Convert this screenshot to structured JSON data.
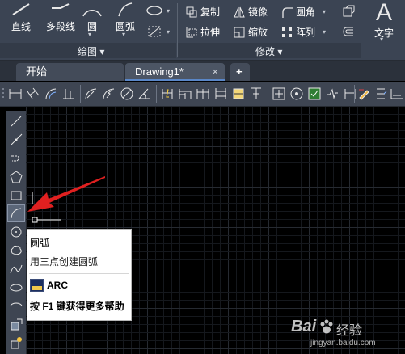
{
  "ribbon": {
    "draw": {
      "line_label": "直线",
      "polyline_label": "多段线",
      "circle_label": "圆",
      "arc_label": "圆弧",
      "panel_title": "绘图 ▾"
    },
    "modify": {
      "copy_label": "复制",
      "mirror_label": "镜像",
      "fillet_label": "圆角",
      "stretch_label": "拉伸",
      "scale_label": "缩放",
      "array_label": "阵列",
      "panel_title": "修改 ▾"
    },
    "annotation": {
      "text_big": "A",
      "text_label": "文字"
    }
  },
  "tabs": [
    {
      "label": "开始"
    },
    {
      "label": "Drawing1*",
      "close": "×"
    }
  ],
  "new_tab_label": "+",
  "tooltip": {
    "title": "圆弧",
    "description": "用三点创建圆弧",
    "command": "ARC",
    "help": "按 F1 键获得更多帮助"
  },
  "watermark": {
    "brand": "Bai",
    "suffix": "经验",
    "url": "jingyan.baidu.com"
  },
  "colors": {
    "ribbon_bg": "#3b4453",
    "toolbar_bg": "#3e4552",
    "canvas_bg": "#000000",
    "grid_minor": "#15181d",
    "grid_major": "#262a31",
    "icon": "#e8e8e8",
    "arrow": "#e02020"
  }
}
